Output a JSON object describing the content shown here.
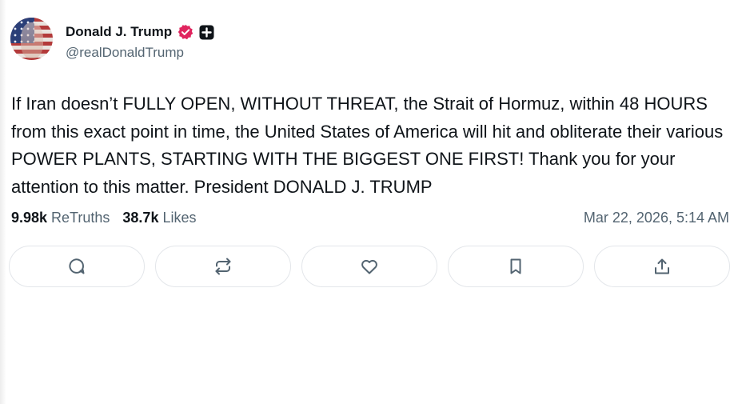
{
  "author": {
    "display_name": "Donald J. Trump",
    "handle": "@realDonaldTrump",
    "verified_icon": "verified-badge-icon",
    "plus_icon": "plus-badge-icon"
  },
  "post": {
    "text": "If Iran doesn’t FULLY OPEN, WITHOUT THREAT, the Strait of Hormuz, within 48 HOURS from this exact point in time, the United States of America will hit and obliterate their various POWER PLANTS, STARTING WITH THE BIGGEST ONE FIRST! Thank you for your attention to this matter. President DONALD J. TRUMP",
    "retruths_count": "9.98k",
    "retruths_label": "ReTruths",
    "likes_count": "38.7k",
    "likes_label": "Likes",
    "timestamp": "Mar 22, 2026, 5:14 AM"
  },
  "actions": [
    {
      "icon": "reply-icon"
    },
    {
      "icon": "retruth-icon"
    },
    {
      "icon": "like-icon"
    },
    {
      "icon": "bookmark-icon"
    },
    {
      "icon": "share-icon"
    }
  ],
  "colors": {
    "text": "#0f1419",
    "muted": "#536471",
    "verified": "#e0245e",
    "border": "#e3e6ea"
  }
}
